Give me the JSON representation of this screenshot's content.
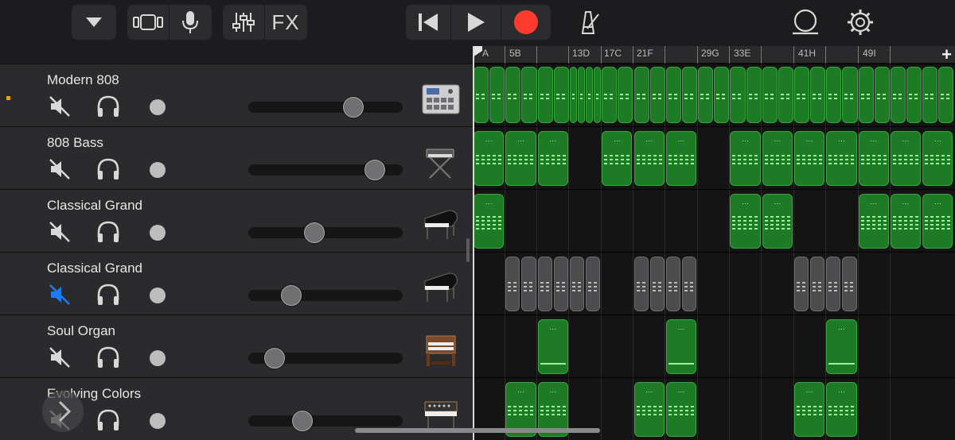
{
  "colors": {
    "record": "#ff3b30",
    "region_green": "#1d7a25",
    "region_gray": "#4c4c4e",
    "mute_active": "#1e7cf2",
    "selected_mark": "#e7a00e"
  },
  "toolbar": {
    "icons": [
      "dropdown-triangle-icon",
      "tracks-view-icon",
      "microphone-icon",
      "mixer-icon",
      "rewind-icon",
      "play-icon",
      "record-icon",
      "metronome-icon",
      "loop-browser-icon",
      "settings-gear-icon"
    ],
    "fx_label": "FX"
  },
  "ruler": {
    "labels": [
      "A",
      "5B",
      "13D",
      "17C",
      "21F",
      "29G",
      "33E",
      "41H",
      "49I"
    ],
    "add_label": "+"
  },
  "tracks": [
    {
      "name": "Modern 808",
      "instrument": "drum-machine-icon",
      "muted": false,
      "volume": 0.68,
      "selected": true
    },
    {
      "name": "808 Bass",
      "instrument": "synth-keyboard-icon",
      "muted": false,
      "volume": 0.82,
      "selected": false
    },
    {
      "name": "Classical Grand",
      "instrument": "grand-piano-icon",
      "muted": false,
      "volume": 0.43,
      "selected": false
    },
    {
      "name": "Classical Grand",
      "instrument": "grand-piano-icon",
      "muted": true,
      "volume": 0.28,
      "selected": false
    },
    {
      "name": "Soul Organ",
      "instrument": "organ-icon",
      "muted": false,
      "volume": 0.17,
      "selected": false
    },
    {
      "name": "Evolving Colors",
      "instrument": "analog-synth-icon",
      "muted": false,
      "volume": 0.35,
      "selected": false
    }
  ]
}
